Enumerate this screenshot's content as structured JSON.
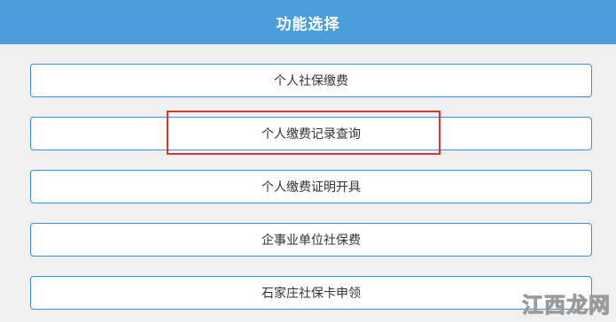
{
  "header": {
    "title": "功能选择"
  },
  "menu": {
    "items": [
      {
        "label": "个人社保缴费"
      },
      {
        "label": "个人缴费记录查询"
      },
      {
        "label": "个人缴费证明开具"
      },
      {
        "label": "企事业单位社保费"
      },
      {
        "label": "石家庄社保卡申领"
      }
    ]
  },
  "watermark": {
    "text": "江西龙网"
  },
  "colors": {
    "header_bg": "#4a9fdb",
    "button_border": "#3d8fd1",
    "highlight": "#e0352f",
    "page_bg": "#f0f0f0"
  }
}
